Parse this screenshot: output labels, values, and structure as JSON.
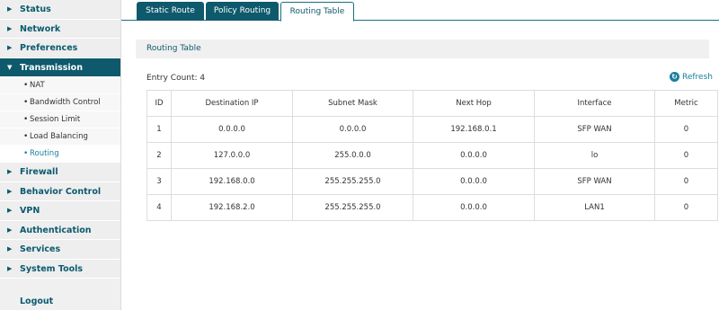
{
  "sidebar": {
    "items": [
      {
        "label": "Status"
      },
      {
        "label": "Network"
      },
      {
        "label": "Preferences"
      },
      {
        "label": "Transmission"
      },
      {
        "label": "Firewall"
      },
      {
        "label": "Behavior Control"
      },
      {
        "label": "VPN"
      },
      {
        "label": "Authentication"
      },
      {
        "label": "Services"
      },
      {
        "label": "System Tools"
      }
    ],
    "subitems": [
      {
        "label": "NAT"
      },
      {
        "label": "Bandwidth Control"
      },
      {
        "label": "Session Limit"
      },
      {
        "label": "Load Balancing"
      },
      {
        "label": "Routing"
      }
    ],
    "logout": "Logout"
  },
  "tabs": [
    {
      "label": "Static Route"
    },
    {
      "label": "Policy Routing"
    },
    {
      "label": "Routing Table"
    }
  ],
  "section_title": "Routing Table",
  "entry_count": "Entry Count: 4",
  "refresh_label": "Refresh",
  "table": {
    "headers": [
      "ID",
      "Destination IP",
      "Subnet Mask",
      "Next Hop",
      "Interface",
      "Metric"
    ],
    "rows": [
      [
        "1",
        "0.0.0.0",
        "0.0.0.0",
        "192.168.0.1",
        "SFP WAN",
        "0"
      ],
      [
        "2",
        "127.0.0.0",
        "255.0.0.0",
        "0.0.0.0",
        "lo",
        "0"
      ],
      [
        "3",
        "192.168.0.0",
        "255.255.255.0",
        "0.0.0.0",
        "SFP WAN",
        "0"
      ],
      [
        "4",
        "192.168.2.0",
        "255.255.255.0",
        "0.0.0.0",
        "LAN1",
        "0"
      ]
    ]
  },
  "colors": {
    "accent": "#0e5a6c",
    "link": "#1a7ea0"
  }
}
